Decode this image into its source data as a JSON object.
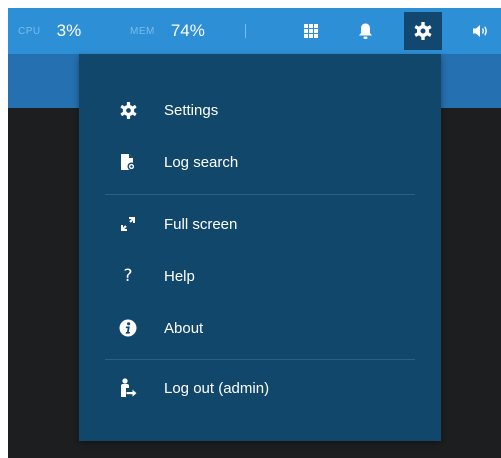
{
  "topbar": {
    "cpu_label": "CPU",
    "cpu_value": "3%",
    "mem_label": "MEM",
    "mem_value": "74%",
    "icons": [
      "grid-icon",
      "bell-icon",
      "gear-icon",
      "speaker-icon"
    ]
  },
  "menu": {
    "items": [
      {
        "label": "Settings",
        "icon": "gear-icon"
      },
      {
        "label": "Log search",
        "icon": "log-search-icon"
      },
      {
        "label": "Full screen",
        "icon": "fullscreen-icon"
      },
      {
        "label": "Help",
        "icon": "help-icon",
        "glyph": "?"
      },
      {
        "label": "About",
        "icon": "info-icon"
      },
      {
        "label": "Log out (admin)",
        "icon": "logout-icon"
      }
    ]
  },
  "colors": {
    "topbar": "#2d8fd6",
    "strip": "#2570b0",
    "menu_bg": "#12476c",
    "active_icon_bg": "#124870",
    "content_bg": "#1d1e20"
  }
}
